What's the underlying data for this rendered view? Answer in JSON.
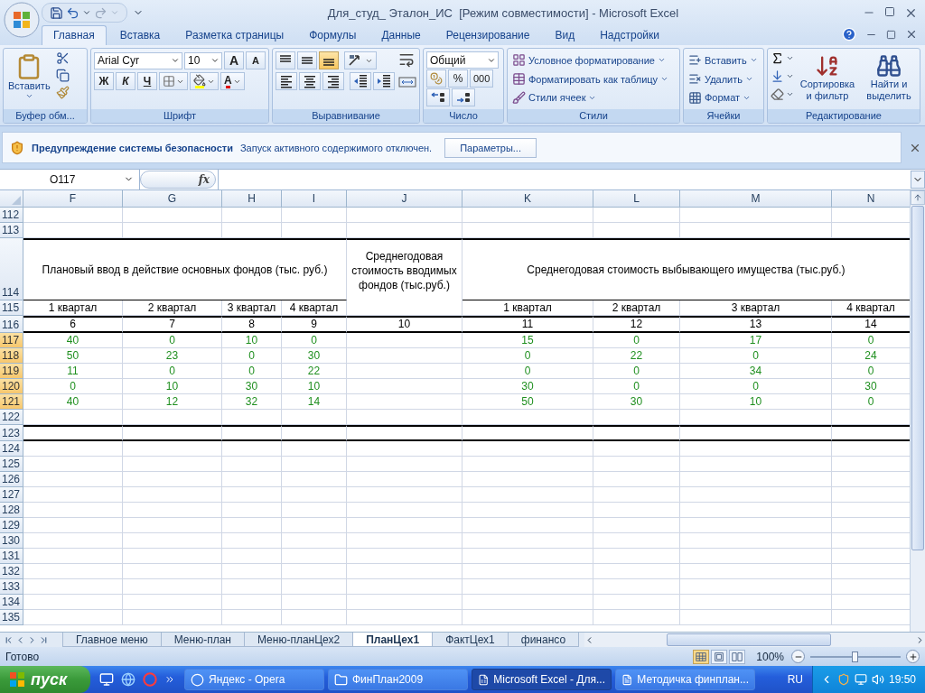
{
  "window": {
    "title": "Для_студ_ Эталон_ИС  [Режим совместимости] - Microsoft Excel"
  },
  "ribbon_tabs": [
    {
      "label": "Главная",
      "selected": true
    },
    {
      "label": "Вставка",
      "selected": false
    },
    {
      "label": "Разметка страницы",
      "selected": false
    },
    {
      "label": "Формулы",
      "selected": false
    },
    {
      "label": "Данные",
      "selected": false
    },
    {
      "label": "Рецензирование",
      "selected": false
    },
    {
      "label": "Вид",
      "selected": false
    },
    {
      "label": "Надстройки",
      "selected": false
    }
  ],
  "clipboard": {
    "paste": "Вставить",
    "group": "Буфер обм..."
  },
  "font": {
    "name": "Arial Cyr",
    "size": "10",
    "grow": "A",
    "shrink": "A",
    "bold": "Ж",
    "italic": "К",
    "underline": "Ч",
    "color_letter": "A",
    "group": "Шрифт"
  },
  "alignment": {
    "vertical": [
      {
        "kind": "top",
        "selected": false
      },
      {
        "kind": "middle",
        "selected": false
      },
      {
        "kind": "bottom",
        "selected": true
      }
    ],
    "group": "Выравнивание"
  },
  "number": {
    "format": "Общий",
    "percent": "%",
    "thousands": "000",
    "group": "Число"
  },
  "styles": {
    "items": [
      "Условное форматирование",
      "Форматировать как таблицу",
      "Стили ячеек"
    ],
    "group": "Стили"
  },
  "cells": {
    "items": [
      "Вставить",
      "Удалить",
      "Формат"
    ],
    "group": "Ячейки"
  },
  "editing": {
    "sort": "Сортировка и фильтр",
    "find": "Найти и выделить",
    "group": "Редактирование"
  },
  "security_bar": {
    "title": "Предупреждение системы безопасности",
    "message": "Запуск активного содержимого отключен.",
    "button": "Параметры..."
  },
  "formula_bar": {
    "name_box": "O117",
    "function_label": "fx"
  },
  "sheet": {
    "columns": [
      "F",
      "G",
      "H",
      "I",
      "J",
      "K",
      "L",
      "M",
      "N"
    ],
    "rows": [
      {
        "number": "112",
        "selected": false,
        "kind": "blank"
      },
      {
        "number": "113",
        "selected": false,
        "kind": "blank"
      },
      {
        "number": "114",
        "selected": false,
        "kind": "group-header",
        "groups": [
          "Плановый ввод в действие основных фондов (тыс. руб.)",
          "Среднегодовая стоимость вводимых фондов (тыс.руб.)",
          "Среднегодовая стоимость выбывающего имущества (тыс.руб.)"
        ]
      },
      {
        "number": "115",
        "selected": false,
        "kind": "quarters",
        "values": [
          "1 квартал",
          "2 квартал",
          "3 квартал",
          "4 квартал",
          "1 квартал",
          "2 квартал",
          "3 квартал",
          "4 квартал"
        ]
      },
      {
        "number": "116",
        "selected": false,
        "kind": "numbers",
        "values": [
          "6",
          "7",
          "8",
          "9",
          "10",
          "11",
          "12",
          "13",
          "14"
        ]
      },
      {
        "number": "117",
        "selected": true,
        "kind": "data",
        "values": [
          "40",
          "0",
          "10",
          "0",
          "15",
          "0",
          "17",
          "0"
        ]
      },
      {
        "number": "118",
        "selected": true,
        "kind": "data",
        "values": [
          "50",
          "23",
          "0",
          "30",
          "0",
          "22",
          "0",
          "24"
        ]
      },
      {
        "number": "119",
        "selected": true,
        "kind": "data",
        "values": [
          "11",
          "0",
          "0",
          "22",
          "0",
          "0",
          "34",
          "0"
        ]
      },
      {
        "number": "120",
        "selected": true,
        "kind": "data",
        "values": [
          "0",
          "10",
          "30",
          "10",
          "30",
          "0",
          "0",
          "30"
        ]
      },
      {
        "number": "121",
        "selected": true,
        "kind": "data",
        "values": [
          "40",
          "12",
          "32",
          "14",
          "50",
          "30",
          "10",
          "0"
        ]
      },
      {
        "number": "122",
        "selected": false,
        "kind": "blank"
      },
      {
        "number": "123",
        "selected": false,
        "kind": "band"
      },
      {
        "number": "124",
        "selected": false,
        "kind": "blank"
      },
      {
        "number": "125",
        "selected": false,
        "kind": "blank"
      },
      {
        "number": "126",
        "selected": false,
        "kind": "blank"
      },
      {
        "number": "127",
        "selected": false,
        "kind": "blank"
      },
      {
        "number": "128",
        "selected": false,
        "kind": "blank"
      },
      {
        "number": "129",
        "selected": false,
        "kind": "blank"
      },
      {
        "number": "130",
        "selected": false,
        "kind": "blank"
      },
      {
        "number": "131",
        "selected": false,
        "kind": "blank"
      },
      {
        "number": "132",
        "selected": false,
        "kind": "blank"
      },
      {
        "number": "133",
        "selected": false,
        "kind": "blank"
      },
      {
        "number": "134",
        "selected": false,
        "kind": "blank"
      },
      {
        "number": "135",
        "selected": false,
        "kind": "blank"
      }
    ]
  },
  "sheet_tabs": [
    {
      "label": "Главное меню",
      "selected": false
    },
    {
      "label": "Меню-план",
      "selected": false
    },
    {
      "label": "Меню-планЦех2",
      "selected": false
    },
    {
      "label": "ПланЦех1",
      "selected": true
    },
    {
      "label": "ФактЦех1",
      "selected": false
    },
    {
      "label": "финансо",
      "selected": false
    }
  ],
  "status_bar": {
    "text": "Готово",
    "views": [
      {
        "kind": "normal",
        "selected": true
      },
      {
        "kind": "page-layout",
        "selected": false
      },
      {
        "kind": "page-break",
        "selected": false
      }
    ],
    "zoom": "100%",
    "zoom_slider": {
      "level": 0.5
    }
  },
  "taskbar": {
    "start": "пуск",
    "tasks": [
      {
        "label": "Яндекс - Opera",
        "kind": "browser",
        "selected": false
      },
      {
        "label": "ФинПлан2009",
        "kind": "folder",
        "selected": false
      },
      {
        "label": "Microsoft Excel - Для...",
        "kind": "spreadsheet",
        "selected": true
      },
      {
        "label": "Методичка финплан...",
        "kind": "document",
        "selected": false
      }
    ],
    "language": "RU",
    "clock": "19:50"
  }
}
